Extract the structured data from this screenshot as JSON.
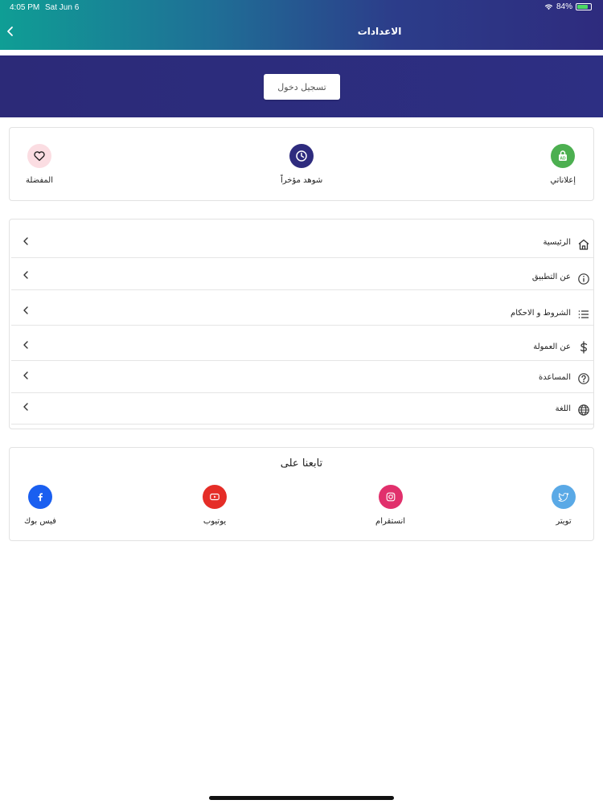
{
  "status_bar": {
    "time": "4:05 PM",
    "date": "Sat Jun 6",
    "battery_text": "84%",
    "battery_level": 0.84
  },
  "header": {
    "title": "الاعدادات",
    "back_icon": "chevron-left-icon"
  },
  "hero": {
    "login_label": "تسجيل دخول"
  },
  "quick_links": [
    {
      "label": "إعلاناتي",
      "icon": "ads-icon",
      "color": "#4caf50"
    },
    {
      "label": "شوهد مؤخراً",
      "icon": "clock-icon",
      "color": "#2e2b7e"
    },
    {
      "label": "المفضلة",
      "icon": "heart-icon",
      "color": "#fbdde2"
    }
  ],
  "menu": [
    {
      "label": "الرئيسية",
      "icon": "home-icon"
    },
    {
      "label": "عن التطبيق",
      "icon": "info-icon"
    },
    {
      "label": "الشروط و الاحكام",
      "icon": "list-icon"
    },
    {
      "label": "عن العمولة",
      "icon": "dollar-icon"
    },
    {
      "label": "المساعدة",
      "icon": "help-icon"
    },
    {
      "label": "اللغة",
      "icon": "globe-icon"
    }
  ],
  "follow": {
    "title": "تابعنا على",
    "socials": [
      {
        "label": "تويتر",
        "icon": "twitter-icon",
        "color": "#5aa9e6"
      },
      {
        "label": "انستقرام",
        "icon": "instagram-icon",
        "color": "#e1306c"
      },
      {
        "label": "يوتيوب",
        "icon": "youtube-icon",
        "color": "#e52d27"
      },
      {
        "label": "فيس بوك",
        "icon": "facebook-icon",
        "color": "#1a5ff0"
      }
    ]
  }
}
